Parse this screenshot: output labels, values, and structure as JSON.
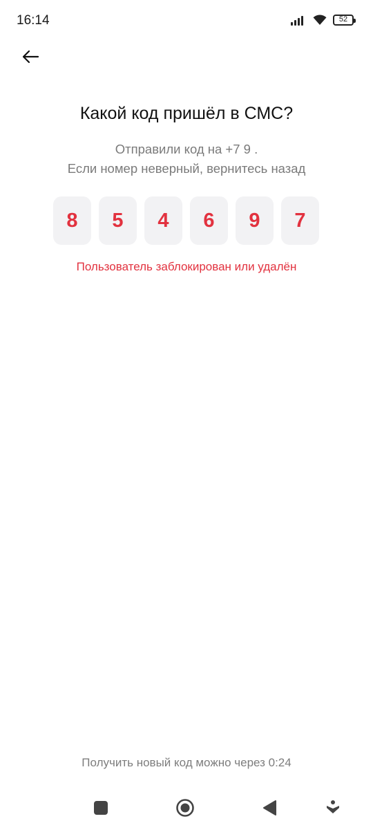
{
  "status_bar": {
    "time": "16:14",
    "battery": "52"
  },
  "header": {
    "back_icon": "arrow-left-icon"
  },
  "main": {
    "title": "Какой код пришёл в СМС?",
    "subtitle_line1": "Отправили код на +7 9               .",
    "subtitle_line2": "Если номер неверный, вернитесь назад",
    "code_digits": [
      "8",
      "5",
      "4",
      "6",
      "9",
      "7"
    ],
    "error": "Пользователь заблокирован или удалён",
    "resend": "Получить новый код можно через 0:24"
  },
  "colors": {
    "accent_error": "#e2323f",
    "box_bg": "#f2f2f4"
  },
  "nav_bar": {
    "icons": [
      "square-icon",
      "circle-home-icon",
      "back-triangle-icon",
      "accessibility-icon"
    ]
  }
}
